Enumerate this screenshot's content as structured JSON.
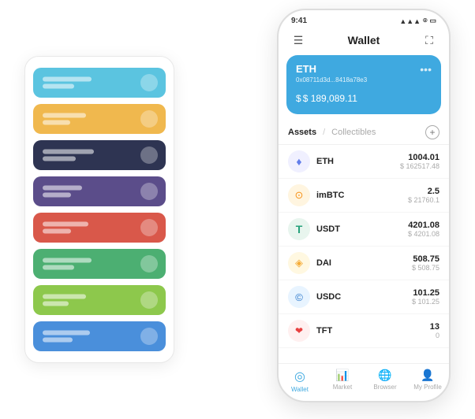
{
  "scene": {
    "cards": [
      {
        "id": "c1",
        "color": "#5bc4e0",
        "line1_width": 60,
        "line2_width": 40
      },
      {
        "id": "c2",
        "color": "#f0b84e",
        "line1_width": 55,
        "line2_width": 35
      },
      {
        "id": "c3",
        "color": "#2e3452",
        "line1_width": 65,
        "line2_width": 42
      },
      {
        "id": "c4",
        "color": "#5b4d8a",
        "line1_width": 50,
        "line2_width": 38
      },
      {
        "id": "c5",
        "color": "#d9584a",
        "line1_width": 58,
        "line2_width": 36
      },
      {
        "id": "c6",
        "color": "#4caf72",
        "line1_width": 62,
        "line2_width": 40
      },
      {
        "id": "c7",
        "color": "#8dc84c",
        "line1_width": 55,
        "line2_width": 33
      },
      {
        "id": "c8",
        "color": "#4a8fdb",
        "line1_width": 60,
        "line2_width": 38
      }
    ]
  },
  "phone": {
    "status_time": "9:41",
    "header_title": "Wallet",
    "eth_card": {
      "title": "ETH",
      "address": "0x08711d3d...8418a78e3",
      "amount": "$ 189,089.11",
      "currency_symbol": "$"
    },
    "tabs": {
      "active": "Assets",
      "inactive": "Collectibles"
    },
    "assets": [
      {
        "symbol": "ETH",
        "icon": "♦",
        "icon_color": "#627eea",
        "amount": "1004.01",
        "usd": "$ 162517.48"
      },
      {
        "symbol": "imBTC",
        "icon": "⊙",
        "icon_color": "#f7931a",
        "amount": "2.5",
        "usd": "$ 21760.1"
      },
      {
        "symbol": "USDT",
        "icon": "T",
        "icon_color": "#26a17b",
        "amount": "4201.08",
        "usd": "$ 4201.08"
      },
      {
        "symbol": "DAI",
        "icon": "◈",
        "icon_color": "#f5ac37",
        "amount": "508.75",
        "usd": "$ 508.75"
      },
      {
        "symbol": "USDC",
        "icon": "©",
        "icon_color": "#2775ca",
        "amount": "101.25",
        "usd": "$ 101.25"
      },
      {
        "symbol": "TFT",
        "icon": "❤",
        "icon_color": "#e84040",
        "amount": "13",
        "usd": "0"
      }
    ],
    "nav": [
      {
        "label": "Wallet",
        "icon": "◎",
        "active": true
      },
      {
        "label": "Market",
        "icon": "📈",
        "active": false
      },
      {
        "label": "Browser",
        "icon": "👤",
        "active": false
      },
      {
        "label": "My Profile",
        "icon": "👤",
        "active": false
      }
    ]
  }
}
